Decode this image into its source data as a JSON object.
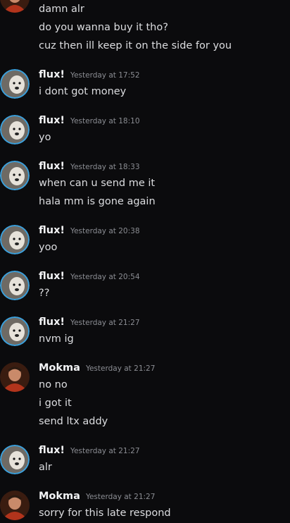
{
  "colors": {
    "background": "#0b0b0d",
    "name": "#f2f3f5",
    "text": "#dcdde0",
    "timestamp": "#8b8d93",
    "flux_ring": "#3ba0dc"
  },
  "messages": [
    {
      "author": "",
      "avatar": "mokma-avatar",
      "time": "",
      "lines": [
        "damn alr",
        "do you wanna buy it tho?",
        "cuz then ill keep it on the side for you"
      ]
    },
    {
      "author": "flux!",
      "avatar": "flux-avatar",
      "time": "Yesterday at 17:52",
      "lines": [
        "i dont got money"
      ]
    },
    {
      "author": "flux!",
      "avatar": "flux-avatar",
      "time": "Yesterday at 18:10",
      "lines": [
        "yo"
      ]
    },
    {
      "author": "flux!",
      "avatar": "flux-avatar",
      "time": "Yesterday at 18:33",
      "lines": [
        "when can u send me it",
        "hala mm is gone again"
      ]
    },
    {
      "author": "flux!",
      "avatar": "flux-avatar",
      "time": "Yesterday at 20:38",
      "lines": [
        "yoo"
      ]
    },
    {
      "author": "flux!",
      "avatar": "flux-avatar",
      "time": "Yesterday at 20:54",
      "lines": [
        "??"
      ]
    },
    {
      "author": "flux!",
      "avatar": "flux-avatar",
      "time": "Yesterday at 21:27",
      "lines": [
        "nvm ig"
      ]
    },
    {
      "author": "Mokma",
      "avatar": "mokma-avatar",
      "time": "Yesterday at 21:27",
      "lines": [
        "no no",
        "i got it",
        "send ltx addy"
      ]
    },
    {
      "author": "flux!",
      "avatar": "flux-avatar",
      "time": "Yesterday at 21:27",
      "lines": [
        "alr"
      ]
    },
    {
      "author": "Mokma",
      "avatar": "mokma-avatar",
      "time": "Yesterday at 21:27",
      "lines": [
        "sorry for this late respond"
      ]
    }
  ]
}
